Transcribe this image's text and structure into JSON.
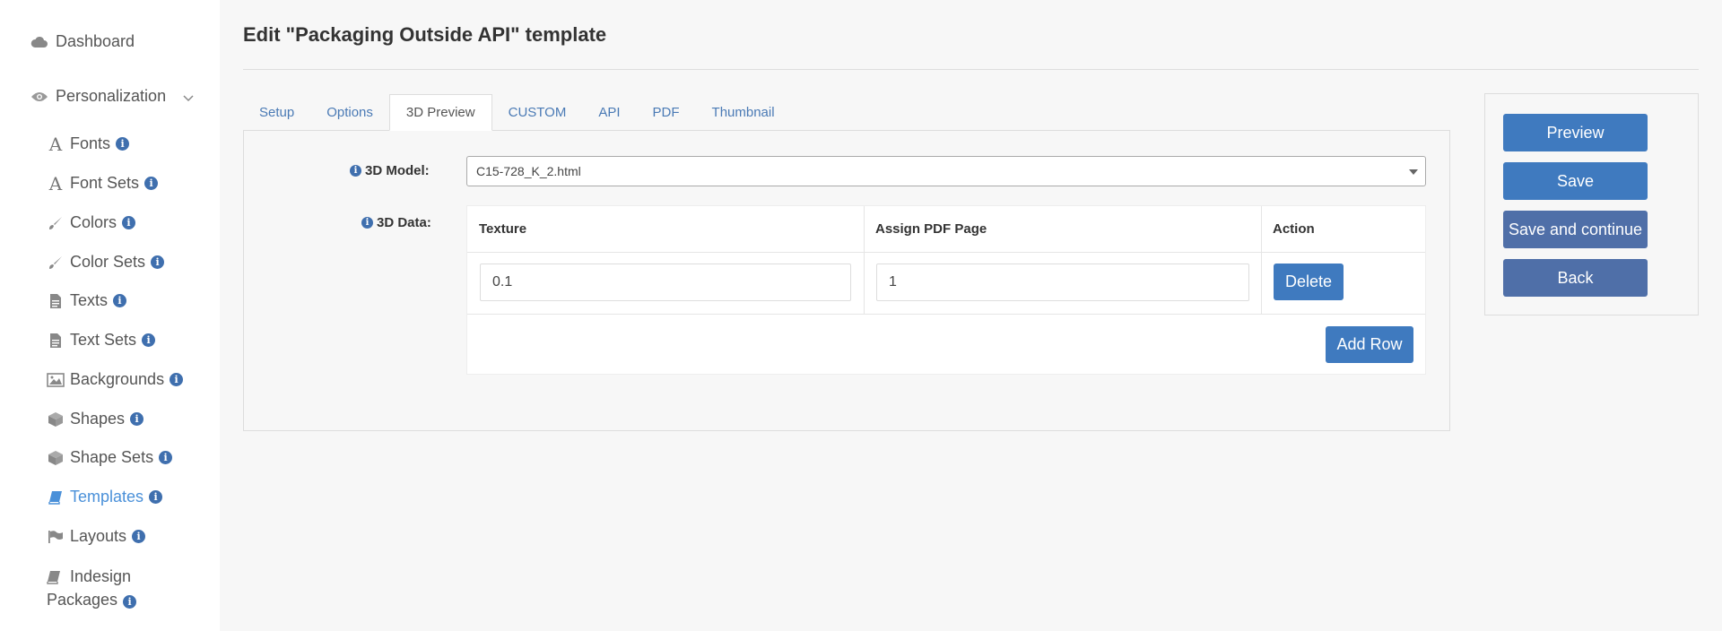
{
  "sidebar": {
    "dashboard": "Dashboard",
    "personalization": "Personalization",
    "items": [
      {
        "label": "Fonts",
        "icon": "font-icon"
      },
      {
        "label": "Font Sets",
        "icon": "font-icon"
      },
      {
        "label": "Colors",
        "icon": "brush-icon"
      },
      {
        "label": "Color Sets",
        "icon": "brush-icon"
      },
      {
        "label": "Texts",
        "icon": "file-text-icon"
      },
      {
        "label": "Text Sets",
        "icon": "file-text-icon"
      },
      {
        "label": "Backgrounds",
        "icon": "image-icon"
      },
      {
        "label": "Shapes",
        "icon": "cube-icon"
      },
      {
        "label": "Shape Sets",
        "icon": "cube-icon"
      },
      {
        "label": "Templates",
        "icon": "book-icon"
      },
      {
        "label": "Layouts",
        "icon": "flag-icon"
      }
    ],
    "indesign": "Indesign Packages",
    "active_item": "Templates",
    "info_glyph": "i"
  },
  "page": {
    "title": "Edit \"Packaging Outside API\" template"
  },
  "tabs": [
    {
      "label": "Setup"
    },
    {
      "label": "Options"
    },
    {
      "label": "3D Preview"
    },
    {
      "label": "CUSTOM"
    },
    {
      "label": "API"
    },
    {
      "label": "PDF"
    },
    {
      "label": "Thumbnail"
    }
  ],
  "active_tab": "3D Preview",
  "form": {
    "model_label": "3D Model:",
    "model_value": "C15-728_K_2.html",
    "data_label": "3D Data:",
    "table": {
      "headers": [
        "Texture",
        "Assign PDF Page",
        "Action"
      ],
      "rows": [
        {
          "texture": "0.1",
          "pdf_page": "1",
          "action": "Delete"
        }
      ],
      "add_row": "Add Row"
    }
  },
  "actions": {
    "preview": "Preview",
    "save": "Save",
    "save_continue": "Save and continue",
    "back": "Back"
  },
  "colors": {
    "primary": "#3f7abf",
    "secondary": "#4f6fa8",
    "link": "#4a7ab5",
    "active_nav": "#4a90d9",
    "info_badge": "#3f6fae"
  }
}
